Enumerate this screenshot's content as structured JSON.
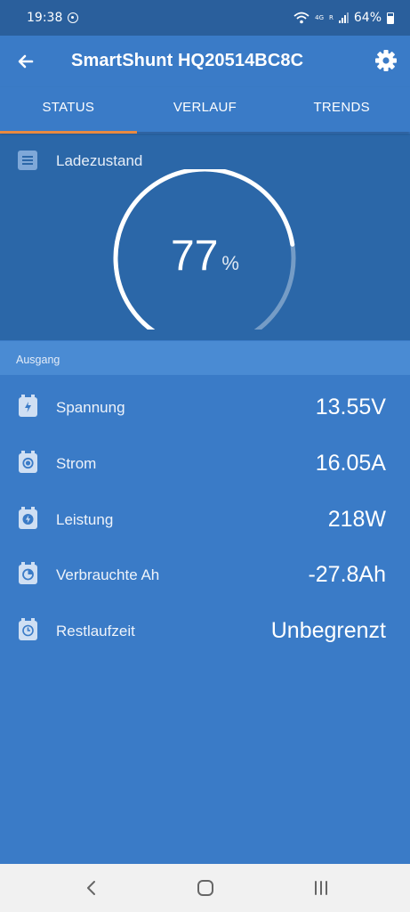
{
  "status_bar": {
    "time": "19:38",
    "network_small_top": "4G",
    "network_small_bottom": "R",
    "battery": "64%"
  },
  "app_bar": {
    "title": "SmartShunt HQ20514BC8C"
  },
  "tabs": [
    {
      "label": "STATUS",
      "active": true
    },
    {
      "label": "VERLAUF",
      "active": false
    },
    {
      "label": "TRENDS",
      "active": false
    }
  ],
  "soc": {
    "label": "Ladezustand",
    "value": "77",
    "unit": "%",
    "fraction": 0.77
  },
  "section": {
    "label": "Ausgang"
  },
  "rows": [
    {
      "icon": "lightning-battery-icon",
      "label": "Spannung",
      "value": "13.55V"
    },
    {
      "icon": "current-battery-icon",
      "label": "Strom",
      "value": "16.05A"
    },
    {
      "icon": "power-battery-icon",
      "label": "Leistung",
      "value": "218W"
    },
    {
      "icon": "consumed-battery-icon",
      "label": "Verbrauchte Ah",
      "value": "-27.8Ah"
    },
    {
      "icon": "clock-battery-icon",
      "label": "Restlaufzeit",
      "value": "Unbegrenzt"
    }
  ],
  "colors": {
    "accent": "#e98a40",
    "primary": "#3a7bc7",
    "dark": "#2b67a8"
  }
}
